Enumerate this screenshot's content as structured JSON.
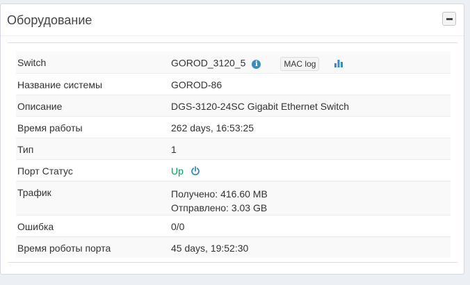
{
  "panel": {
    "title": "Оборудование",
    "collapse_icon": "minus-icon"
  },
  "rows": [
    {
      "label": "Switch",
      "value": "GOROD_3120_5",
      "info_icon": "info-circle-icon",
      "mac_button": "MAC log",
      "graph_icon": "bar-chart-icon"
    },
    {
      "label": "Название системы",
      "value": "GOROD-86"
    },
    {
      "label": "Описание",
      "value": "DGS-3120-24SC Gigabit Ethernet Switch"
    },
    {
      "label": "Время работы",
      "value": "262 days, 16:53:25"
    },
    {
      "label": "Тип",
      "value": "1"
    },
    {
      "label": "Порт Статус",
      "value": "Up",
      "status_color": "#00a65a",
      "power_icon": "power-icon"
    },
    {
      "label": "Трафик",
      "received": "Получено: 416.60 MB",
      "sent": "Отправлено: 3.03 GB"
    },
    {
      "label": "Ошибка",
      "value": "0/0"
    },
    {
      "label": "Время роботы порта",
      "value": "45 days, 19:52:30"
    }
  ]
}
